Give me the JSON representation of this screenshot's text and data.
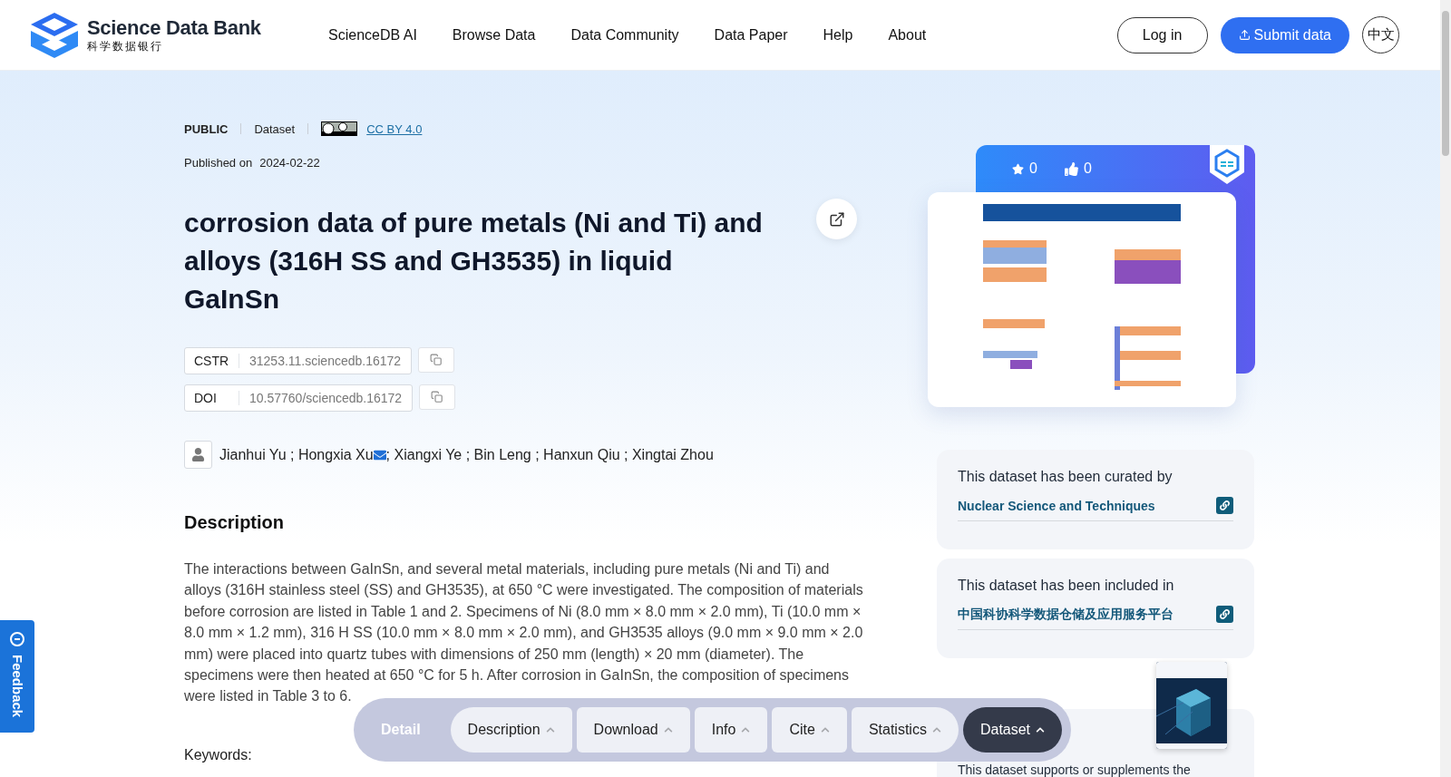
{
  "header": {
    "logo": {
      "name": "Science Data Bank",
      "subtitle": "科学数据银行"
    },
    "nav": [
      "ScienceDB AI",
      "Browse Data",
      "Data Community",
      "Data Paper",
      "Help",
      "About"
    ],
    "login": "Log in",
    "submit": "Submit data",
    "language": "中文"
  },
  "meta": {
    "access": "PUBLIC",
    "type": "Dataset",
    "license": "CC BY 4.0",
    "published_label": "Published on",
    "published_date": "2024-02-22"
  },
  "title": "corrosion data of pure metals (Ni and Ti) and alloys (316H SS and GH3535) in liquid GaInSn",
  "identifiers": [
    {
      "label": "CSTR",
      "value": "31253.11.sciencedb.16172"
    },
    {
      "label": "DOI",
      "value": "10.57760/sciencedb.16172"
    }
  ],
  "authors": {
    "separator": ";",
    "list": [
      {
        "name": "Jianhui Yu",
        "email": false
      },
      {
        "name": "Hongxia Xu",
        "email": true
      },
      {
        "name": "Xiangxi Ye",
        "email": false
      },
      {
        "name": "Bin Leng",
        "email": false
      },
      {
        "name": "Hanxun Qiu",
        "email": false
      },
      {
        "name": "Xingtai Zhou",
        "email": false
      }
    ]
  },
  "description": {
    "heading": "Description",
    "text": "The interactions between GaInSn, and several metal materials, including pure metals (Ni and Ti) and alloys (316H stainless steel (SS) and GH3535), at 650 °C were investigated. The composition of materials before corrosion are listed in Table 1 and 2. Specimens of Ni (8.0 mm × 8.0 mm × 2.0 mm), Ti (10.0 mm × 8.0 mm × 1.2 mm), 316 H SS (10.0 mm × 8.0 mm × 2.0 mm), and GH3535 alloys (9.0 mm × 9.0 mm × 2.0 mm) were placed into quartz tubes with dimensions of 250 mm (length) × 20 mm (diameter). The specimens were then heated at 650 °C for 5 h. After corrosion in GaInSn, the composition of specimens were listed in Table 3 to 6."
  },
  "keywords_label": "Keywords:",
  "stats": {
    "favorites": "0",
    "likes": "0"
  },
  "curation": [
    {
      "heading": "This dataset has been curated by",
      "link": "Nuclear Science and Techniques"
    },
    {
      "heading": "This dataset has been included in",
      "link": "中国科协科学数据仓储及应用服务平台"
    }
  ],
  "support_text": "This dataset supports or supplements the",
  "detail_bar": {
    "label": "Detail",
    "tabs": [
      {
        "label": "Description",
        "selected": false
      },
      {
        "label": "Download",
        "selected": false
      },
      {
        "label": "Info",
        "selected": false
      },
      {
        "label": "Cite",
        "selected": false
      },
      {
        "label": "Statistics",
        "selected": false
      },
      {
        "label": "Dataset",
        "selected": true
      }
    ]
  },
  "feedback": "Feedback"
}
